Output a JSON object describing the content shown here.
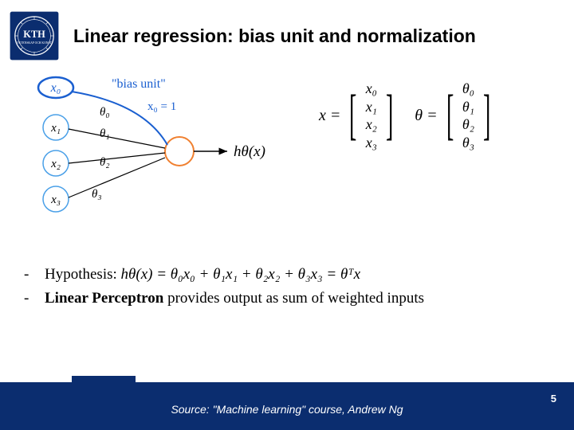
{
  "title": "Linear regression: bias unit and normalization",
  "logo_text": "KTH",
  "diagram": {
    "bias_label": "\"bias unit\"",
    "bias_value": "x₀ = 1",
    "nodes": [
      "x₀",
      "x₁",
      "x₂",
      "x₃"
    ],
    "weights": [
      "θ₀",
      "θ₁",
      "θ₂",
      "θ₃"
    ],
    "output": "hθ(x)"
  },
  "vectors": {
    "x_label": "x =",
    "x_entries": [
      "x₀",
      "x₁",
      "x₂",
      "x₃"
    ],
    "theta_label": "θ =",
    "theta_entries": [
      "θ₀",
      "θ₁",
      "θ₂",
      "θ₃"
    ]
  },
  "bullets": {
    "hypothesis_label": "Hypothesis:",
    "hypothesis_eq": "hθ(x) = θ₀x₀ + θ₁x₁ + θ₂x₂ + θ₃x₃ = θᵀx",
    "perceptron_strong": "Linear Perceptron",
    "perceptron_rest": " provides output as sum of weighted inputs"
  },
  "footer": {
    "source": "Source: \"Machine learning\" course, Andrew Ng",
    "page": "5"
  }
}
